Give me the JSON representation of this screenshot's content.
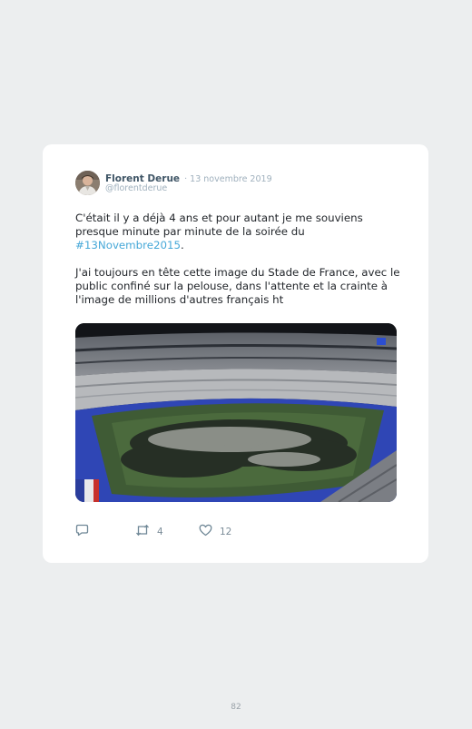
{
  "tweet": {
    "author_name": "Florent Derue",
    "date": "· 13 novembre 2019",
    "handle": "@florentderue",
    "text_part1": "C'était il y a déjà 4 ans et pour autant je me souviens presque minute par minute de la soirée du ",
    "hashtag": "#13Novembre2015",
    "text_part1_end": ".",
    "text_part2": "J'ai toujours en tête cette image du Stade de France, avec le public confiné sur la pelouse, dans l'attente et la crainte à l'image de millions d'autres français ht",
    "retweets": "4",
    "likes": "12"
  },
  "icons": {
    "reply": "reply-icon",
    "retweet": "retweet-icon",
    "like": "heart-icon"
  },
  "page_number": "82"
}
